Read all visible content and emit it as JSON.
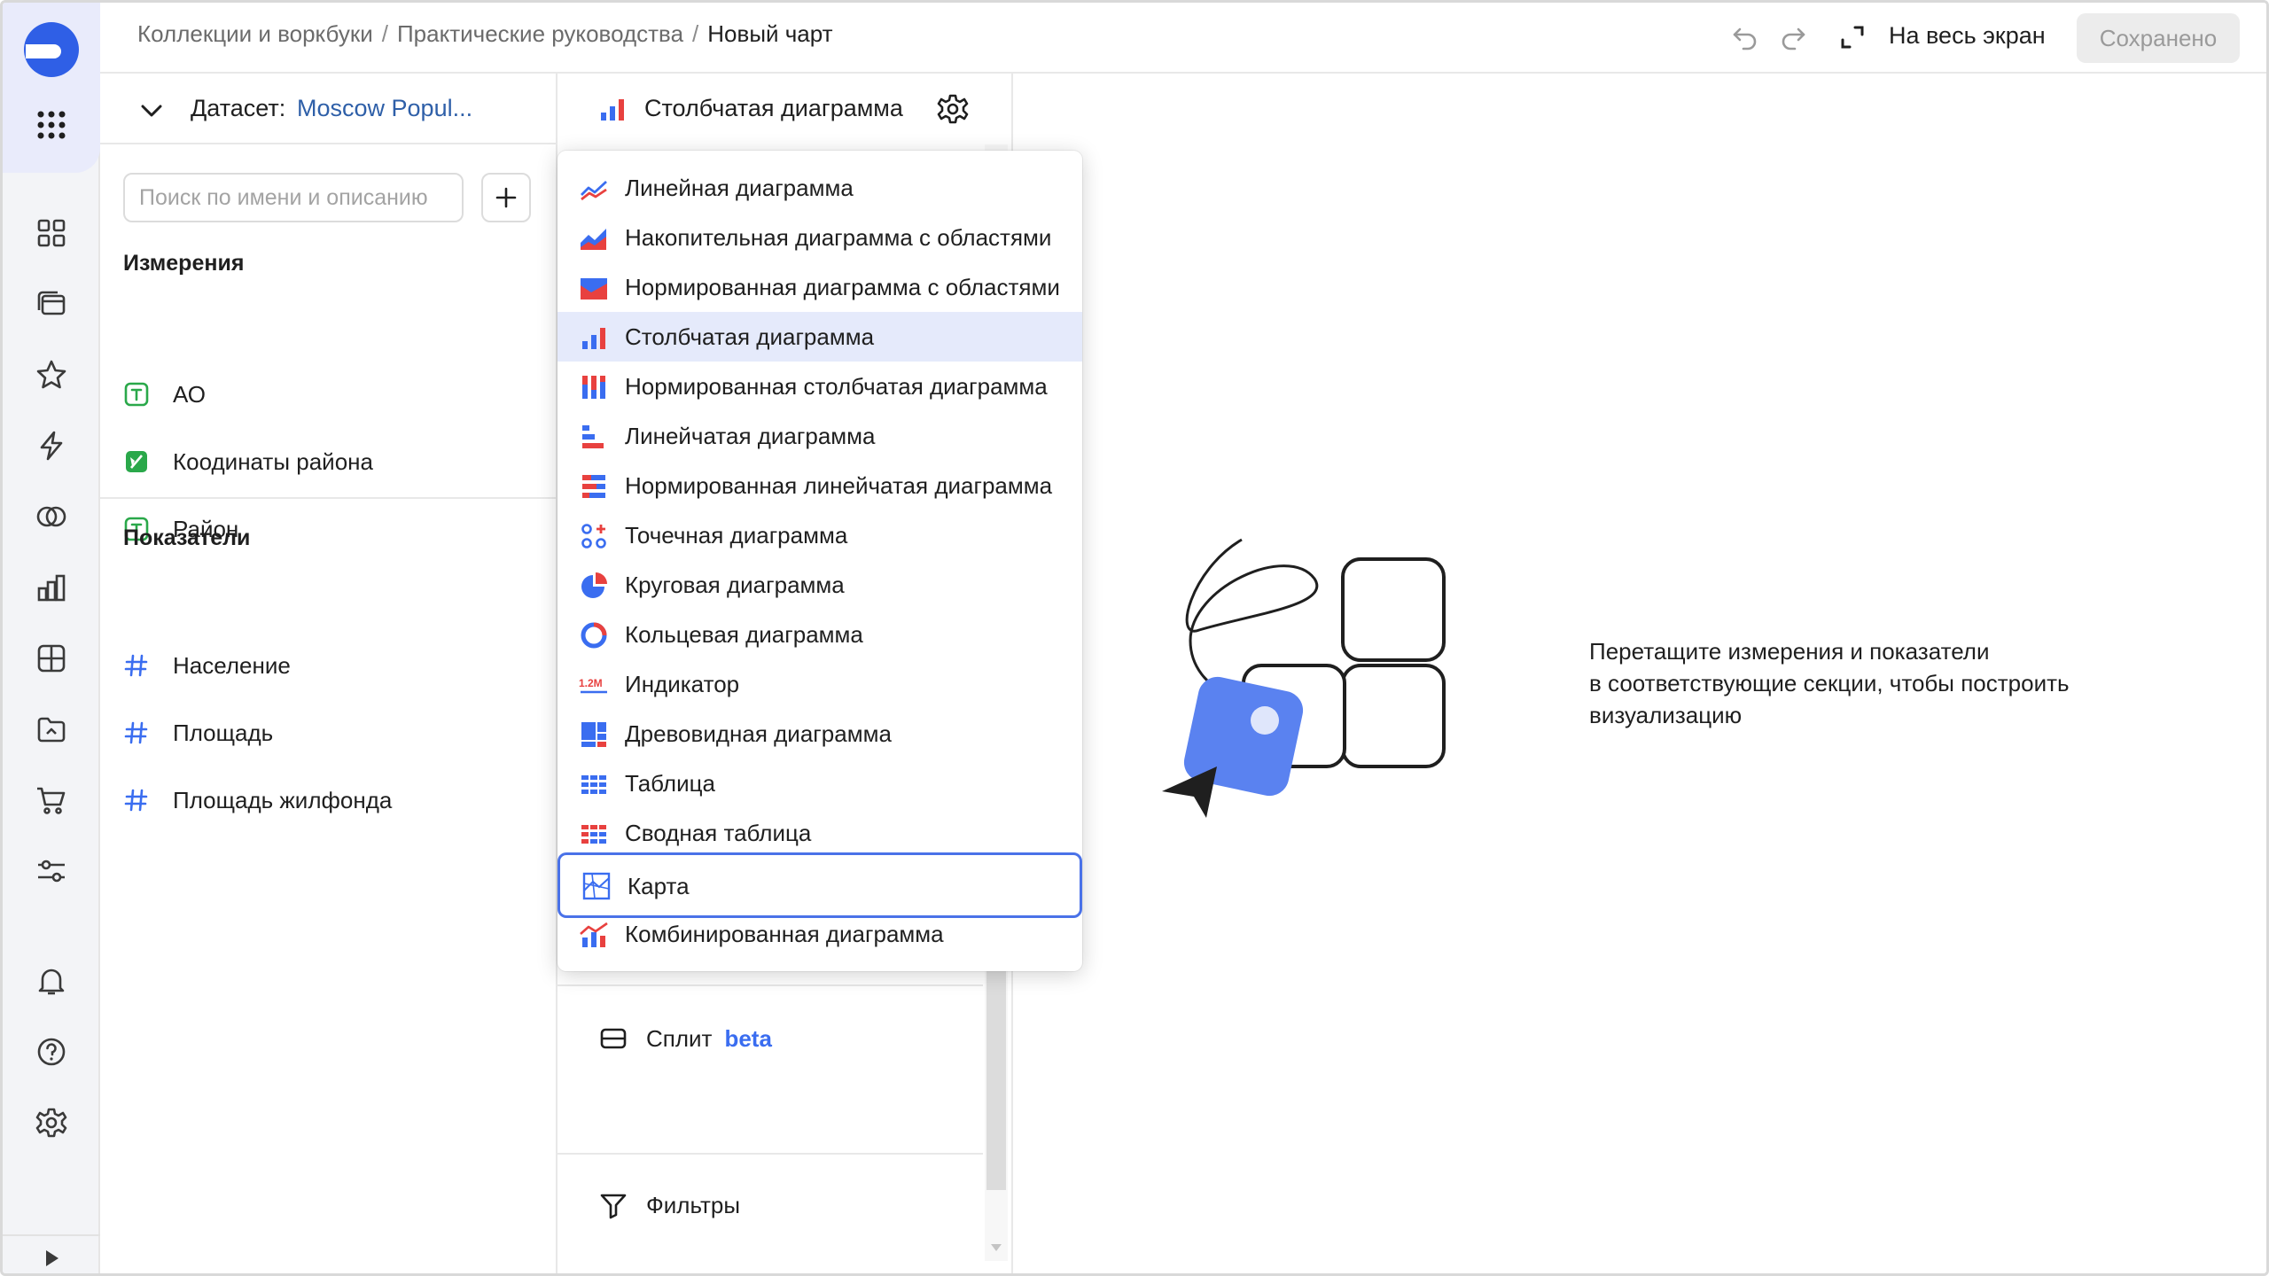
{
  "header": {
    "breadcrumb": [
      "Коллекции и воркбуки",
      "Практические руководства"
    ],
    "separator": "/",
    "current": "Новый чарт",
    "fullscreen_label": "На весь экран",
    "saved_label": "Сохранено"
  },
  "dataset": {
    "label": "Датасет:",
    "name": "Moscow Popul...",
    "search_placeholder": "Поиск по имени и описанию",
    "dimensions_title": "Измерения",
    "dimensions": [
      "АО",
      "Коодинаты района",
      "Район"
    ],
    "measures_title": "Показатели",
    "measures": [
      "Население",
      "Площадь",
      "Площадь жилфонда"
    ]
  },
  "visualization": {
    "current": "Столбчатая диаграмма",
    "split_label": "Сплит",
    "split_badge": "beta",
    "filters_label": "Фильтры"
  },
  "dropdown": {
    "selected": "Столбчатая диаграмма",
    "focused": "Карта",
    "items": [
      {
        "label": "Линейная диаграмма",
        "icon": "line-chart-icon"
      },
      {
        "label": "Накопительная диаграмма с областями",
        "icon": "area-chart-icon"
      },
      {
        "label": "Нормированная диаграмма с областями",
        "icon": "area-normalized-icon"
      },
      {
        "label": "Столбчатая диаграмма",
        "icon": "column-chart-icon"
      },
      {
        "label": "Нормированная столбчатая диаграмма",
        "icon": "column-normalized-icon"
      },
      {
        "label": "Линейчатая диаграмма",
        "icon": "bar-chart-icon"
      },
      {
        "label": "Нормированная линейчатая диаграмма",
        "icon": "bar-normalized-icon"
      },
      {
        "label": "Точечная диаграмма",
        "icon": "scatter-icon"
      },
      {
        "label": "Круговая диаграмма",
        "icon": "pie-icon"
      },
      {
        "label": "Кольцевая диаграмма",
        "icon": "donut-icon"
      },
      {
        "label": "Индикатор",
        "icon": "indicator-icon",
        "icon_text": "1.2M"
      },
      {
        "label": "Древовидная диаграмма",
        "icon": "treemap-icon"
      },
      {
        "label": "Таблица",
        "icon": "table-icon"
      },
      {
        "label": "Сводная таблица",
        "icon": "pivot-table-icon"
      },
      {
        "label": "Карта",
        "icon": "map-icon"
      },
      {
        "label": "Комбинированная диаграмма",
        "icon": "combined-chart-icon"
      }
    ]
  },
  "empty_state": {
    "lines": [
      "Перетащите измерения и показатели",
      "в соответствующие секции, чтобы построить",
      "визуализацию"
    ]
  },
  "colors": {
    "accent": "#3a6df0",
    "red": "#e8413f",
    "selected_bg": "#e5eafb",
    "green": "#2aa84a",
    "link": "#2e5fa8"
  }
}
